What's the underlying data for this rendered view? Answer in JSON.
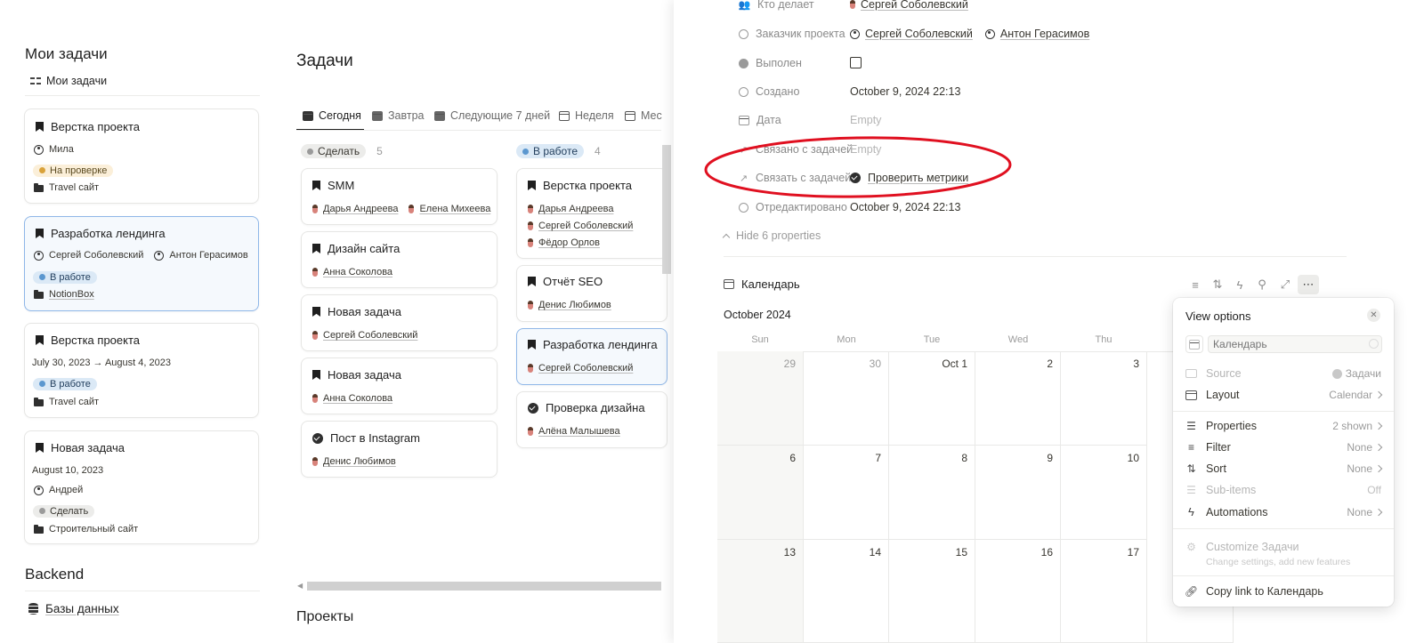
{
  "left": {
    "title": "Мои задачи",
    "view_label": "Мои задачи",
    "cards": [
      {
        "title": "Верстка проекта",
        "person": "Мила",
        "status": "На проверке",
        "project": "Travel сайт"
      },
      {
        "title": "Разработка лендинга",
        "people": [
          "Сергей Соболевский",
          "Антон Герасимов"
        ],
        "status": "В работе",
        "project": "NotionBox"
      },
      {
        "title": "Верстка проекта",
        "date": "July 30, 2023 → August 4, 2023",
        "status": "В работе",
        "project": "Travel сайт"
      },
      {
        "title": "Новая задача",
        "date": "August 10, 2023",
        "person": "Андрей",
        "status": "Сделать",
        "project": "Строительный сайт"
      }
    ],
    "backend_title": "Backend",
    "db_label": "Базы данных"
  },
  "tasks": {
    "title": "Задачи",
    "tabs": [
      "Сегодня",
      "Завтра",
      "Следующие 7 дней",
      "Неделя",
      "Мес"
    ],
    "columns": [
      {
        "label": "Сделать",
        "count": "5",
        "cards": [
          {
            "title": "SMM",
            "people": [
              "Дарья Андреева",
              "Елена Михеева"
            ]
          },
          {
            "title": "Дизайн сайта",
            "people": [
              "Анна Соколова"
            ]
          },
          {
            "title": "Новая задача",
            "people": [
              "Сергей Соболевский"
            ]
          },
          {
            "title": "Новая задача",
            "people": [
              "Анна Соколова"
            ]
          },
          {
            "title": "Пост в Instagram",
            "people": [
              "Денис Любимов"
            ]
          }
        ]
      },
      {
        "label": "В работе",
        "count": "4",
        "cards": [
          {
            "title": "Верстка проекта",
            "people": [
              "Дарья Андреева",
              "Сергей Соболевский",
              "Фёдор Орлов"
            ]
          },
          {
            "title": "Отчёт SEO",
            "people": [
              "Денис Любимов"
            ]
          },
          {
            "title": "Разработка лендинга",
            "people": [
              "Сергей Соболевский"
            ]
          },
          {
            "title": "Проверка дизайна",
            "people": [
              "Алёна Малышева"
            ]
          }
        ]
      }
    ],
    "projects_title": "Проекты"
  },
  "detail": {
    "props": [
      {
        "label": "Кто делает",
        "value": "Сергей Соболевский"
      },
      {
        "label": "Заказчик проекта",
        "values": [
          "Сергей Соболевский",
          "Антон Герасимов"
        ]
      },
      {
        "label": "Выполен",
        "value": ""
      },
      {
        "label": "Создано",
        "value": "October 9, 2024 22:13"
      },
      {
        "label": "Дата",
        "value": "Empty"
      },
      {
        "label": "Связано с задачей",
        "value": "Empty"
      },
      {
        "label": "Связать с задачей",
        "value": "Проверить метрики"
      },
      {
        "label": "Отредактировано",
        "value": "October 9, 2024 22:13"
      }
    ],
    "hide_props": "Hide 6 properties",
    "calendar_label": "Календарь",
    "month": "October 2024",
    "weekdays": [
      "Sun",
      "Mon",
      "Tue",
      "Wed",
      "Thu"
    ],
    "weeks": [
      [
        "29",
        "30",
        "Oct 1",
        "2",
        "3"
      ],
      [
        "6",
        "7",
        "8",
        "9",
        "10"
      ],
      [
        "13",
        "14",
        "15",
        "16",
        "17"
      ]
    ],
    "annotation_color": "#e01020"
  },
  "view_options": {
    "title": "View options",
    "name_placeholder": "Календарь",
    "rows": [
      {
        "label": "Source",
        "value": "Задачи"
      },
      {
        "label": "Layout",
        "value": "Calendar"
      },
      {
        "label": "Properties",
        "value": "2 shown"
      },
      {
        "label": "Filter",
        "value": "None"
      },
      {
        "label": "Sort",
        "value": "None"
      },
      {
        "label": "Sub-items",
        "value": "Off"
      },
      {
        "label": "Automations",
        "value": "None"
      }
    ],
    "customize": "Customize Задачи",
    "customize_sub": "Change settings, add new features",
    "copy_link": "Copy link to Календарь"
  }
}
